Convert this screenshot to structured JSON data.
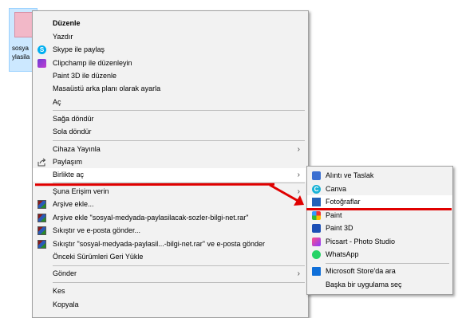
{
  "desktop_file": {
    "name_line1": "sosya",
    "name_line2": "ylasila"
  },
  "context_menu": {
    "items": [
      {
        "label": "Düzenle"
      },
      {
        "label": "Yazdır"
      },
      {
        "label": "Skype ile paylaş",
        "icon": "skype-icon"
      },
      {
        "label": "Clipchamp ile düzenleyin",
        "icon": "clipchamp-icon"
      },
      {
        "label": "Paint 3D ile düzenle"
      },
      {
        "label": "Masaüstü arka planı olarak ayarla"
      },
      {
        "label": "Aç"
      },
      {
        "label": "Sağa döndür"
      },
      {
        "label": "Sola döndür"
      },
      {
        "label": "Cihaza Yayınla",
        "chevron": "›"
      },
      {
        "label": "Paylaşım",
        "icon": "share-icon"
      },
      {
        "label": "Birlikte aç",
        "chevron": "›"
      },
      {
        "label": "Şuna Erişim verin",
        "chevron": "›"
      },
      {
        "label": "Arşive ekle...",
        "icon": "winrar-icon"
      },
      {
        "label": "Arşive ekle \"sosyal-medyada-paylasilacak-sozler-bilgi-net.rar\"",
        "icon": "winrar-icon"
      },
      {
        "label": "Sıkıştır ve e-posta gönder...",
        "icon": "winrar-icon"
      },
      {
        "label": "Sıkıştır \"sosyal-medyada-paylasil...-bilgi-net.rar\" ve e-posta gönder",
        "icon": "winrar-icon"
      },
      {
        "label": "Önceki Sürümleri Geri Yükle"
      },
      {
        "label": "Gönder",
        "chevron": "›"
      },
      {
        "label": "Kes"
      },
      {
        "label": "Kopyala"
      }
    ]
  },
  "open_with_submenu": {
    "items": [
      {
        "label": "Alıntı ve Taslak",
        "icon": "snip-sketch-icon"
      },
      {
        "label": "Canva",
        "icon": "canva-icon"
      },
      {
        "label": "Fotoğraflar",
        "icon": "photos-icon"
      },
      {
        "label": "Paint",
        "icon": "paint-icon"
      },
      {
        "label": "Paint 3D",
        "icon": "paint3d-icon"
      },
      {
        "label": "Picsart - Photo Studio",
        "icon": "picsart-icon"
      },
      {
        "label": "WhatsApp",
        "icon": "whatsapp-icon"
      },
      {
        "label": "Microsoft Store'da ara",
        "icon": "store-icon"
      },
      {
        "label": "Başka bir uygulama seç"
      }
    ]
  },
  "annotation_color": "#e00000"
}
